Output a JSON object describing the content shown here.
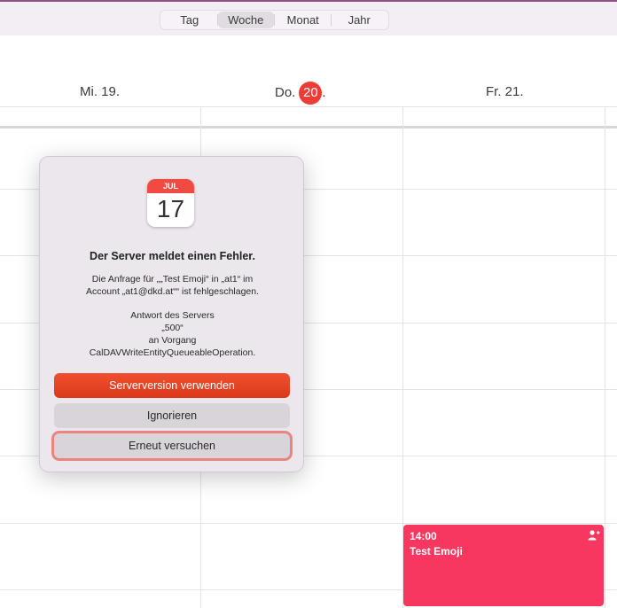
{
  "toolbar": {
    "views": [
      {
        "label": "Tag"
      },
      {
        "label": "Woche"
      },
      {
        "label": "Monat"
      },
      {
        "label": "Jahr"
      }
    ],
    "active_view": "Woche"
  },
  "week": {
    "days": [
      {
        "label": "Mi. 19."
      },
      {
        "label_prefix": "Do.",
        "badge": "20",
        "label_suffix": "."
      },
      {
        "label": "Fr. 21."
      }
    ]
  },
  "event": {
    "time": "14:00",
    "title": "Test Emoji",
    "color": "#f7375f",
    "icon": "person-icon"
  },
  "dialog": {
    "app_icon": {
      "month": "JUL",
      "day": "17"
    },
    "title": "Der Server meldet einen Fehler.",
    "message_line1": "Die Anfrage für „„Test Emoji“ in „at1“ im",
    "message_line2": "Account „at1@dkd.at““ ist fehlgeschlagen.",
    "response_line1": "Antwort des Servers",
    "response_line2": "„500“",
    "response_line3": "an Vorgang",
    "response_line4": "CalDAVWriteEntityQueueableOperation.",
    "buttons": {
      "use_server": "Serverversion verwenden",
      "ignore": "Ignorieren",
      "retry": "Erneut versuchen"
    }
  },
  "colors": {
    "accent_red": "#ef3b35",
    "primary_button": "#dc3819",
    "event": "#f7375f"
  }
}
